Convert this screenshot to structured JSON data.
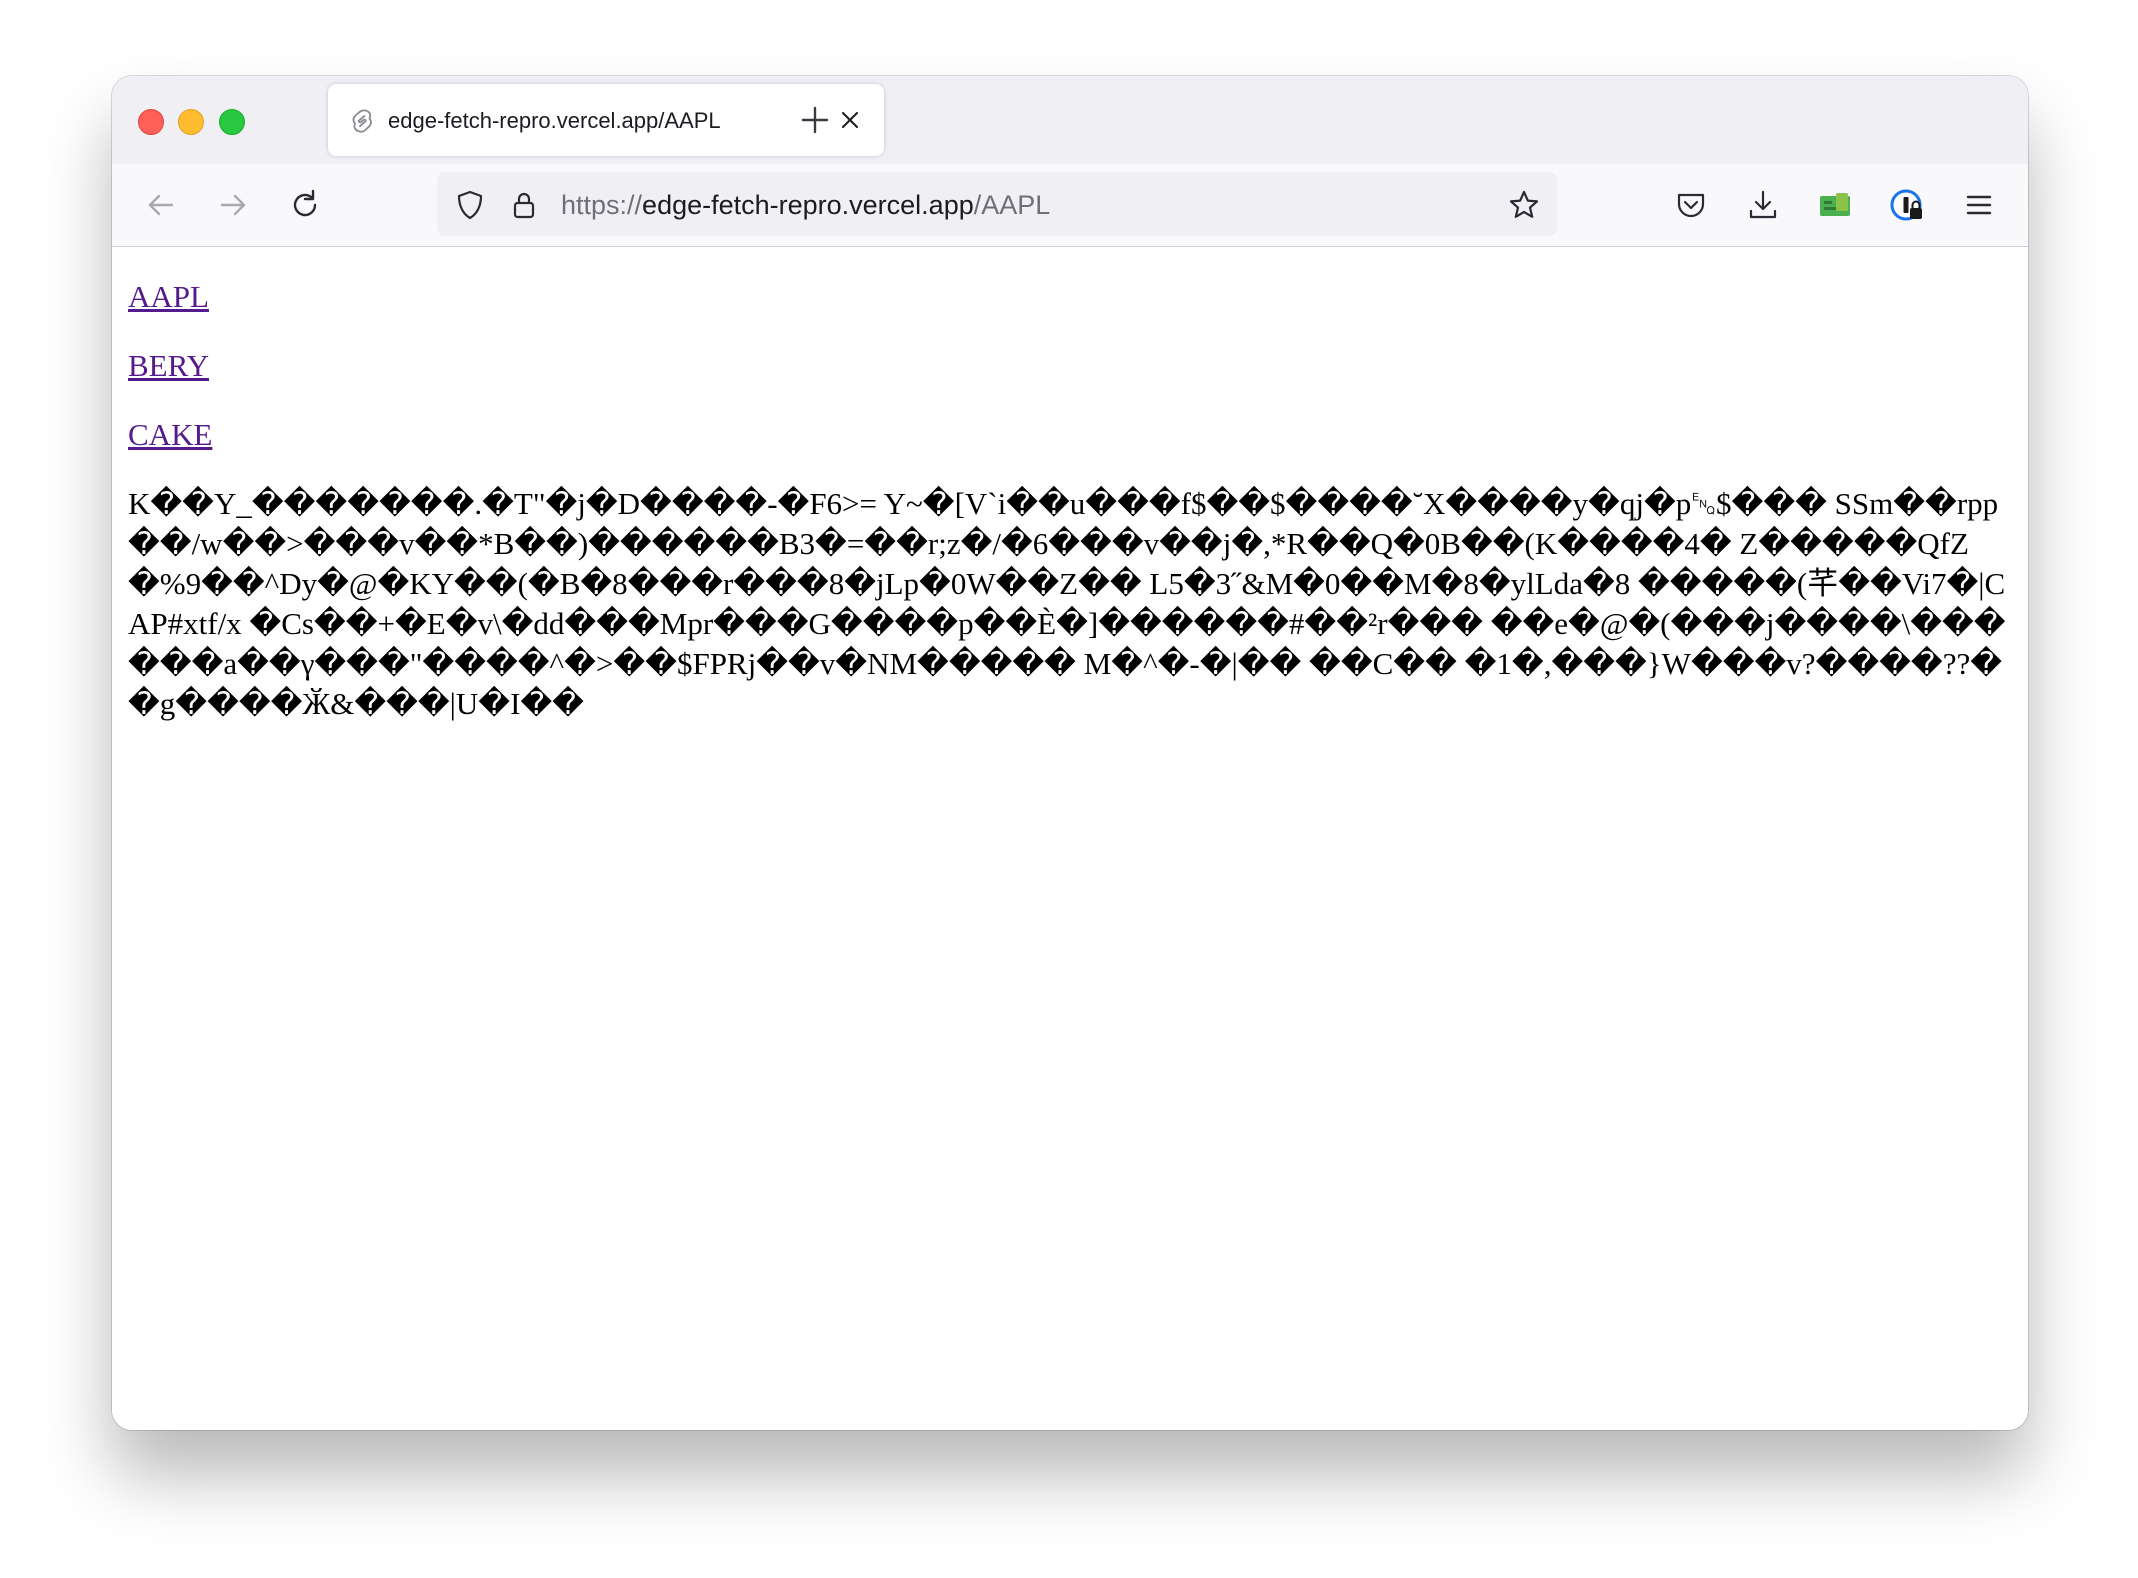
{
  "window": {
    "controls": [
      "close",
      "minimize",
      "zoom"
    ]
  },
  "tab": {
    "title": "edge-fetch-repro.vercel.app/AAPL",
    "favicon": "svelte-icon",
    "close_icon": "close-icon"
  },
  "toolbar": {
    "back_icon": "arrow-left-icon",
    "forward_icon": "arrow-right-icon",
    "reload_icon": "reload-icon",
    "new_tab_icon": "plus-icon",
    "icons_right": [
      "pocket-icon",
      "download-icon",
      "extension-icon",
      "1password-icon",
      "menu-icon"
    ]
  },
  "urlbar": {
    "scheme": "https://",
    "host": "edge-fetch-repro.vercel.app",
    "path": "/AAPL",
    "tracking_icon": "shield-icon",
    "lock_icon": "lock-icon",
    "bookmark_icon": "star-icon"
  },
  "page": {
    "links": [
      "AAPL",
      "BERY",
      "CAKE"
    ],
    "link_color": "#551a8b",
    "body_text": "K��Y_�������.�T\"�j�D����-�F6>= Y~�[V`i��u���f$��$����˘X����y�qj�p␅$��� SSm��rpp��/w��>���v��*B��)������B3�=��r;z�/�6���v��j�,*R��Q�0B��(K����4� Z�����QfZ�%9��^Dy�@�KY��(�B�8���r���8�jLp�0W��Z�� L5�3˝&M�0��M�8�ylLda�8 �����(芊��Vi7�|CAP#xtf/x �Cs��+�E�v\\�dd���Mpr���G����p��È�]������#��²r��� ��e�@�(���j����\\������a��γ���\"����^�>��$FPRj��v�NM����� M�^�-�|�� ��C�� �1�,���}W���v?����??��g����Ӂ&���|U�I��"
  }
}
